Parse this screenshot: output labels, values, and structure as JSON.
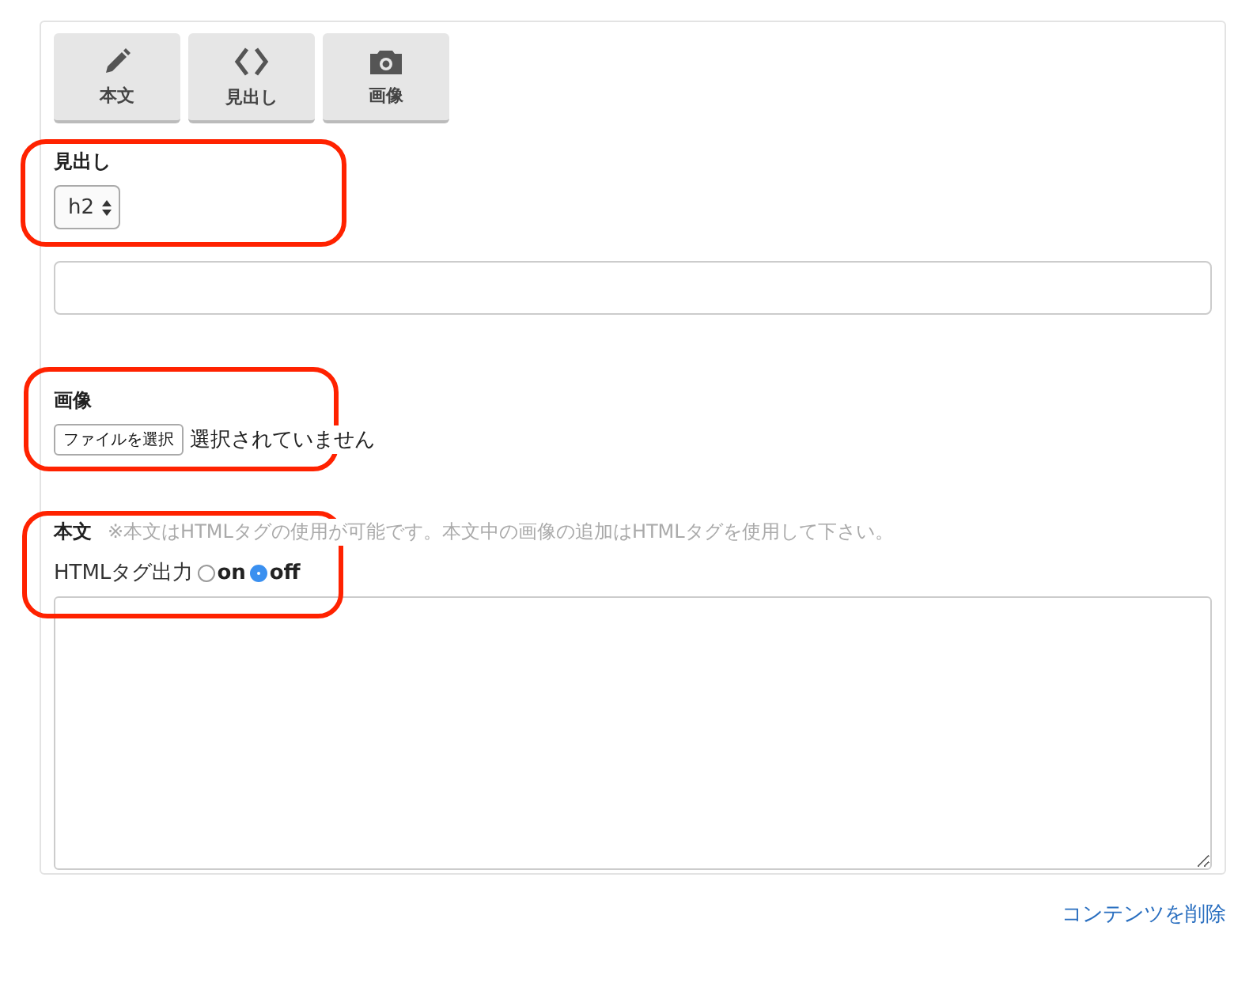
{
  "toolbar": [
    {
      "kind": "pencil",
      "label": "本文"
    },
    {
      "kind": "code",
      "label": "見出し"
    },
    {
      "kind": "camera",
      "label": "画像"
    }
  ],
  "heading_section": {
    "label": "見出し",
    "select_value": "h2"
  },
  "image_section": {
    "label": "画像",
    "button": "ファイルを選択",
    "status": "選択されていません"
  },
  "body_section": {
    "label": "本文",
    "note": "※本文はHTMLタグの使用が可能です。本文中の画像の追加はHTMLタグを使用して下さい。",
    "option_label": "HTMLタグ出力",
    "options": [
      {
        "label": "on",
        "selected": false
      },
      {
        "label": "off",
        "selected": true
      }
    ]
  },
  "delete_link": "コンテンツを削除"
}
